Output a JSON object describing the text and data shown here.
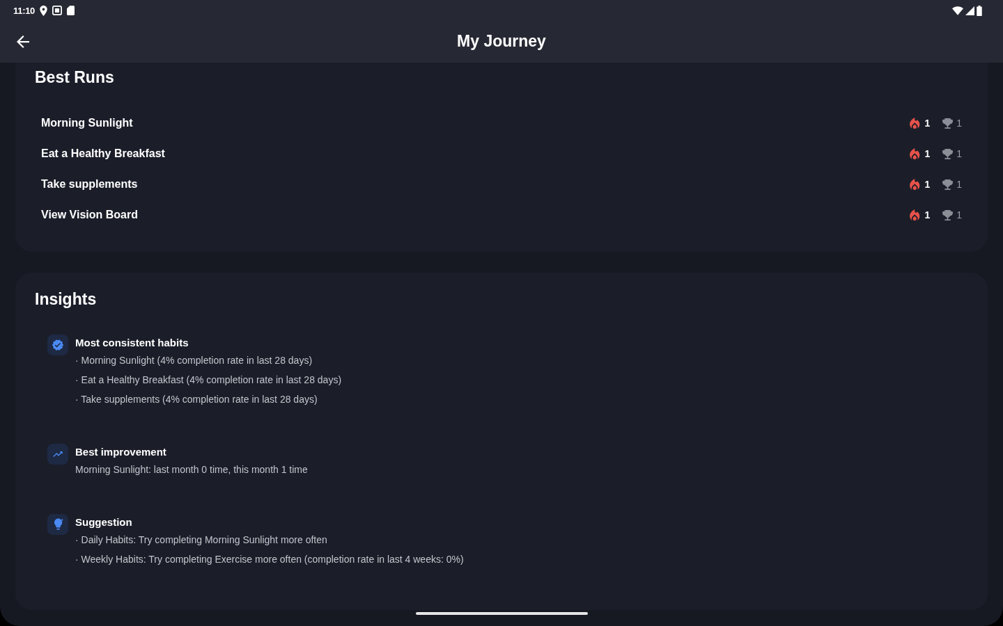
{
  "status_bar": {
    "time": "11:10"
  },
  "app_bar": {
    "title": "My Journey"
  },
  "best_runs": {
    "title": "Best Runs",
    "rows": [
      {
        "name": "Morning Sunlight",
        "streak": "1",
        "best": "1"
      },
      {
        "name": "Eat a Healthy Breakfast",
        "streak": "1",
        "best": "1"
      },
      {
        "name": "Take supplements",
        "streak": "1",
        "best": "1"
      },
      {
        "name": "View Vision Board",
        "streak": "1",
        "best": "1"
      }
    ]
  },
  "insights": {
    "title": "Insights",
    "items": [
      {
        "kind": "consistent",
        "title": "Most consistent habits",
        "lines": [
          "· Morning Sunlight (4% completion rate in last 28 days)",
          "· Eat a Healthy Breakfast (4% completion rate in last 28 days)",
          "· Take supplements (4% completion rate in last 28 days)"
        ]
      },
      {
        "kind": "improvement",
        "title": "Best improvement",
        "lines": [
          "Morning Sunlight: last month 0 time, this month 1 time"
        ]
      },
      {
        "kind": "suggestion",
        "title": "Suggestion",
        "lines": [
          "· Daily Habits: Try completing Morning Sunlight more often",
          "· Weekly Habits: Try completing Exercise more often (completion rate in last 4 weeks: 0%)"
        ]
      }
    ]
  }
}
